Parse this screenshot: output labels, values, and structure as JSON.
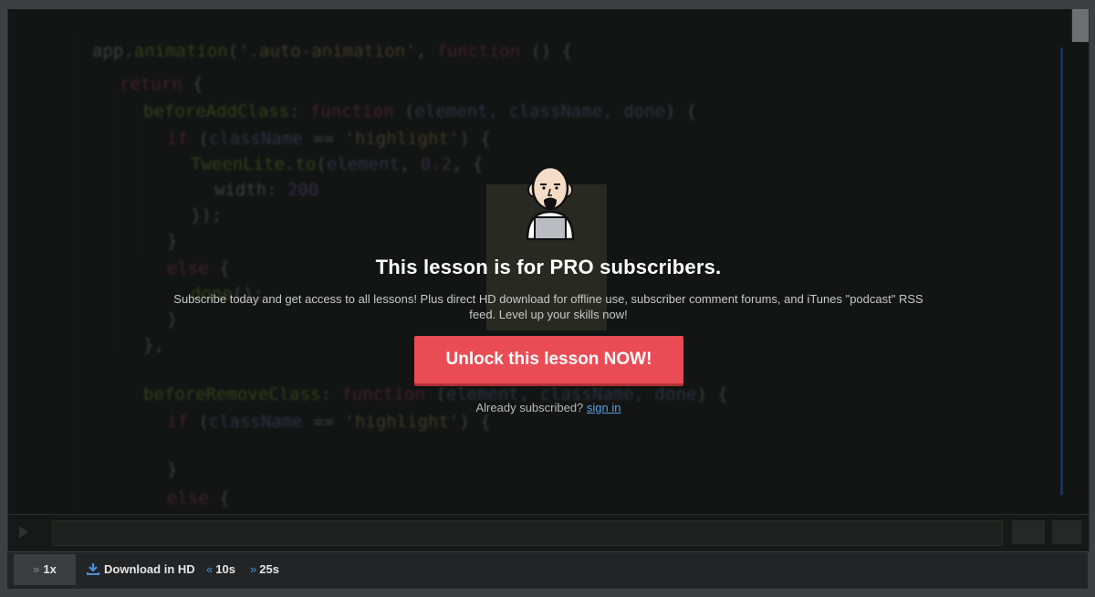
{
  "paywall": {
    "title": "This lesson is for PRO subscribers.",
    "description": "Subscribe today and get access to all lessons! Plus direct HD download for offline use, subscriber comment forums, and iTunes \"podcast\" RSS feed. Level up your skills now!",
    "unlock_label": "Unlock this lesson NOW!",
    "already_text": "Already subscribed?",
    "sign_in_label": "sign in"
  },
  "controls": {
    "speed_label": "1x",
    "download_label": "Download in HD",
    "back_label": "10s",
    "forward_label": "25s"
  },
  "icons": {
    "speed": "double-chevron-right-icon",
    "download": "download-icon",
    "back": "rewind-icon",
    "forward": "fast-forward-icon",
    "mascot": "mascot-with-laptop"
  },
  "colors": {
    "accent": "#ea4c55",
    "link": "#5b9fe0",
    "chevron": "#4a90d9",
    "player_bg": "#131414"
  }
}
